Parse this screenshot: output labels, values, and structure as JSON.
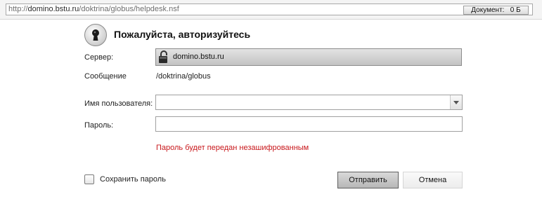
{
  "address_bar": {
    "url_prefix": "http://",
    "url_host": "domino.bstu.ru",
    "url_path": "/doktrina/globus/helpdesk.nsf",
    "doc_status_label": "Документ:",
    "doc_status_value": "0 Б"
  },
  "login": {
    "title": "Пожалуйста, авторизуйтесь",
    "icon": "keyhole-icon",
    "server_label": "Сервер:",
    "server_value": "domino.bstu.ru",
    "server_icon": "padlock-icon",
    "message_label": "Сообщение",
    "message_value": "/doktrina/globus",
    "username_label": "Имя пользователя:",
    "username_value": "",
    "password_label": "Пароль:",
    "password_value": "",
    "warning": "Пароль будет передан незашифрованным",
    "save_password_label": "Сохранить пароль",
    "save_password_checked": false,
    "submit_label": "Отправить",
    "cancel_label": "Отмена"
  },
  "colors": {
    "warning": "#c8171b",
    "server_bar": "#d0d0d0",
    "submit_button": "#c6c6c6"
  }
}
